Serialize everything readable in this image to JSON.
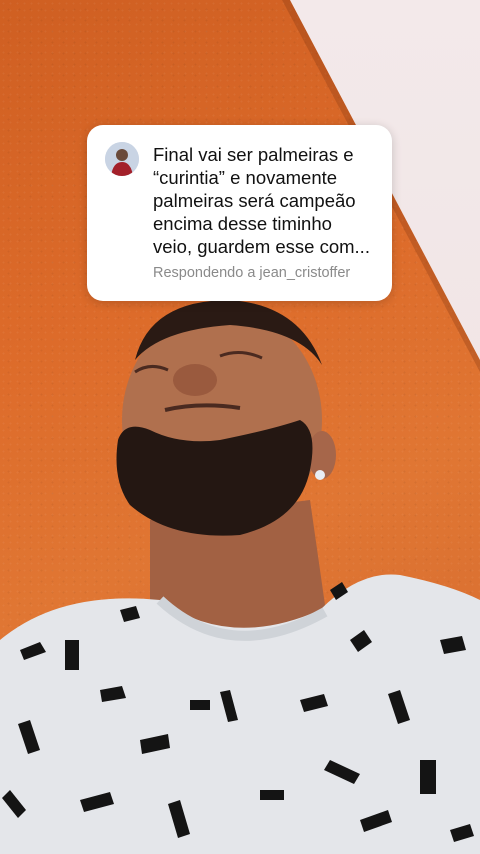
{
  "question_card": {
    "question_text": "Final vai ser palmeiras e\n“curintia” e novamente\npalmeiras será campeão\nencima desse timinho\nveio, guardem esse com...",
    "reply_label": "Respondendo a jean_cristoffer"
  },
  "colors": {
    "card_background": "#ffffff",
    "wall_orange": "#dd6b2a",
    "wall_white": "#f1e6e6"
  }
}
